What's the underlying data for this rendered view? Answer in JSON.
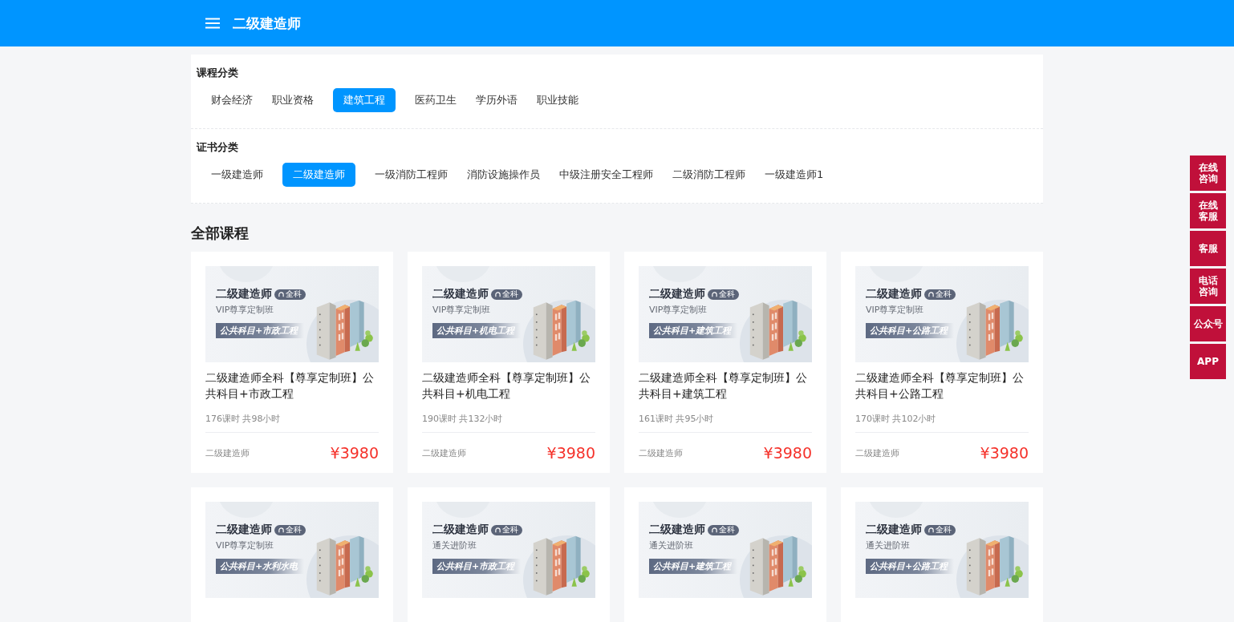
{
  "header": {
    "title": "二级建造师"
  },
  "course_categories": {
    "title": "课程分类",
    "items": [
      {
        "label": "财会经济",
        "selected": false
      },
      {
        "label": "职业资格",
        "selected": false
      },
      {
        "label": "建筑工程",
        "selected": true
      },
      {
        "label": "医药卫生",
        "selected": false
      },
      {
        "label": "学历外语",
        "selected": false
      },
      {
        "label": "职业技能",
        "selected": false
      }
    ]
  },
  "certificate_categories": {
    "title": "证书分类",
    "items": [
      {
        "label": "一级建造师",
        "selected": false
      },
      {
        "label": "二级建造师",
        "selected": true
      },
      {
        "label": "一级消防工程师",
        "selected": false
      },
      {
        "label": "消防设施操作员",
        "selected": false
      },
      {
        "label": "中级注册安全工程师",
        "selected": false
      },
      {
        "label": "二级消防工程师",
        "selected": false
      },
      {
        "label": "一级建造师1",
        "selected": false
      }
    ]
  },
  "section_title": "全部课程",
  "courses": [
    {
      "cover": {
        "title": "二级建造师",
        "badge": "全科",
        "subtitle": "VIP尊享定制班",
        "subject": "公共科目+市政工程"
      },
      "title": "二级建造师全科【尊享定制班】公共科目+市政工程",
      "meta": "176课时 共98小时",
      "certificate": "二级建造师",
      "price": "¥3980"
    },
    {
      "cover": {
        "title": "二级建造师",
        "badge": "全科",
        "subtitle": "VIP尊享定制班",
        "subject": "公共科目+机电工程"
      },
      "title": "二级建造师全科【尊享定制班】公共科目+机电工程",
      "meta": "190课时 共132小时",
      "certificate": "二级建造师",
      "price": "¥3980"
    },
    {
      "cover": {
        "title": "二级建造师",
        "badge": "全科",
        "subtitle": "VIP尊享定制班",
        "subject": "公共科目+建筑工程"
      },
      "title": "二级建造师全科【尊享定制班】公共科目+建筑工程",
      "meta": "161课时 共95小时",
      "certificate": "二级建造师",
      "price": "¥3980"
    },
    {
      "cover": {
        "title": "二级建造师",
        "badge": "全科",
        "subtitle": "VIP尊享定制班",
        "subject": "公共科目+公路工程"
      },
      "title": "二级建造师全科【尊享定制班】公共科目+公路工程",
      "meta": "170课时 共102小时",
      "certificate": "二级建造师",
      "price": "¥3980"
    },
    {
      "cover": {
        "title": "二级建造师",
        "badge": "全科",
        "subtitle": "VIP尊享定制班",
        "subject": "公共科目+水利水电"
      }
    },
    {
      "cover": {
        "title": "二级建造师",
        "badge": "全科",
        "subtitle": "通关进阶班",
        "subject": "公共科目+市政工程"
      }
    },
    {
      "cover": {
        "title": "二级建造师",
        "badge": "全科",
        "subtitle": "通关进阶班",
        "subject": "公共科目+建筑工程"
      }
    },
    {
      "cover": {
        "title": "二级建造师",
        "badge": "全科",
        "subtitle": "通关进阶班",
        "subject": "公共科目+公路工程"
      }
    }
  ],
  "side_buttons": [
    {
      "label": "在线咨询"
    },
    {
      "label": "在线客服"
    },
    {
      "label": "客服"
    },
    {
      "label": "电话咨询"
    },
    {
      "label": "公众号"
    },
    {
      "label": "APP"
    }
  ]
}
